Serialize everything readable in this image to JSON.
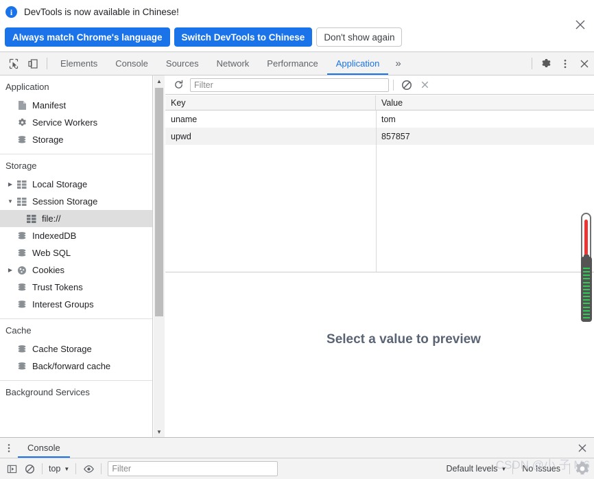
{
  "infobar": {
    "message": "DevTools is now available in Chinese!",
    "icon": "info-icon",
    "buttons": [
      {
        "label": "Always match Chrome's language",
        "style": "primary"
      },
      {
        "label": "Switch DevTools to Chinese",
        "style": "primary"
      },
      {
        "label": "Don't show again",
        "style": "secondary"
      }
    ],
    "close_icon": "close-icon"
  },
  "toolbar": {
    "inspect_icon": "inspect-element-icon",
    "device_icon": "device-toolbar-icon",
    "tabs": [
      {
        "label": "Elements",
        "active": false
      },
      {
        "label": "Console",
        "active": false
      },
      {
        "label": "Sources",
        "active": false
      },
      {
        "label": "Network",
        "active": false
      },
      {
        "label": "Performance",
        "active": false
      },
      {
        "label": "Application",
        "active": true
      }
    ],
    "more_tabs_label": "»",
    "settings_icon": "gear-icon",
    "menu_icon": "kebab-menu-icon",
    "close_icon": "close-icon"
  },
  "sidebar": {
    "groups": [
      {
        "title": "Application",
        "items": [
          {
            "label": "Manifest",
            "icon": "manifest-file-icon",
            "indent": 1,
            "arrow": "none",
            "selected": false
          },
          {
            "label": "Service Workers",
            "icon": "gear-icon",
            "indent": 1,
            "arrow": "none",
            "selected": false
          },
          {
            "label": "Storage",
            "icon": "database-icon",
            "indent": 1,
            "arrow": "none",
            "selected": false
          }
        ]
      },
      {
        "title": "Storage",
        "items": [
          {
            "label": "Local Storage",
            "icon": "table-grid-icon",
            "indent": 0,
            "arrow": "collapsed",
            "selected": false
          },
          {
            "label": "Session Storage",
            "icon": "table-grid-icon",
            "indent": 0,
            "arrow": "expanded",
            "selected": false
          },
          {
            "label": "file://",
            "icon": "table-grid-icon",
            "indent": 2,
            "arrow": "none",
            "selected": true
          },
          {
            "label": "IndexedDB",
            "icon": "database-icon",
            "indent": 1,
            "arrow": "none",
            "selected": false
          },
          {
            "label": "Web SQL",
            "icon": "database-icon",
            "indent": 1,
            "arrow": "none",
            "selected": false
          },
          {
            "label": "Cookies",
            "icon": "cookie-icon",
            "indent": 0,
            "arrow": "collapsed",
            "selected": false
          },
          {
            "label": "Trust Tokens",
            "icon": "database-icon",
            "indent": 1,
            "arrow": "none",
            "selected": false
          },
          {
            "label": "Interest Groups",
            "icon": "database-icon",
            "indent": 1,
            "arrow": "none",
            "selected": false
          }
        ]
      },
      {
        "title": "Cache",
        "items": [
          {
            "label": "Cache Storage",
            "icon": "database-icon",
            "indent": 1,
            "arrow": "none",
            "selected": false
          },
          {
            "label": "Back/forward cache",
            "icon": "database-icon",
            "indent": 1,
            "arrow": "none",
            "selected": false
          }
        ]
      },
      {
        "title": "Background Services",
        "items": []
      }
    ],
    "scroll_up_icon": "scroll-up-arrow-icon",
    "scroll_down_icon": "scroll-down-arrow-icon"
  },
  "storage_panel": {
    "refresh_icon": "refresh-icon",
    "filter_placeholder": "Filter",
    "filter_value": "",
    "clear_all_icon": "clear-all-icon",
    "delete_selected_icon": "delete-selected-icon",
    "table": {
      "columns": [
        "Key",
        "Value"
      ],
      "rows": [
        {
          "key": "uname",
          "value": "tom"
        },
        {
          "key": "upwd",
          "value": "857857"
        }
      ]
    },
    "preview_placeholder": "Select a value to preview"
  },
  "overlay": {
    "thermometer_icon": "thermometer-indicator",
    "battery_icon": "battery-indicator"
  },
  "drawer": {
    "menu_icon": "kebab-menu-icon",
    "tabs": [
      {
        "label": "Console",
        "active": true
      }
    ],
    "close_icon": "close-icon",
    "console": {
      "sidebar_toggle_icon": "console-sidebar-icon",
      "clear_console_icon": "clear-console-icon",
      "context_label": "top",
      "context_caret": "▼",
      "eye_icon": "live-expression-icon",
      "filter_placeholder": "Filter",
      "filter_value": "",
      "levels_label": "Default levels",
      "levels_caret": "▼",
      "issues_label": "No Issues",
      "settings_icon": "gear-icon"
    }
  },
  "watermark": {
    "text": "CSDN @小 子 M6"
  }
}
